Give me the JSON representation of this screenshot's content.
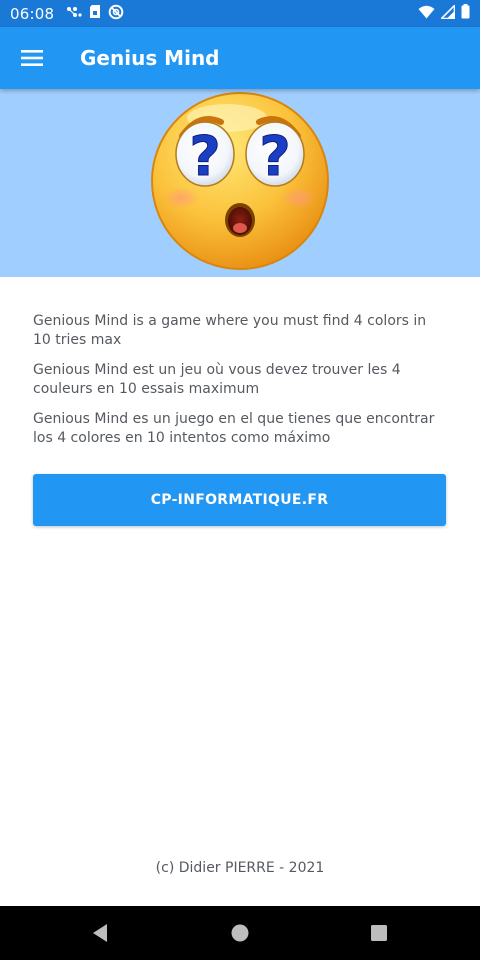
{
  "status_bar": {
    "time": "06:08",
    "left_icons": [
      "network-dots-icon",
      "sim-card-icon",
      "no-disturb-icon"
    ],
    "right_icons": [
      "wifi-icon",
      "signal-icon",
      "battery-icon"
    ]
  },
  "app_bar": {
    "title": "Genius Mind",
    "menu_icon": "hamburger-menu-icon",
    "color": "#2196f3"
  },
  "banner": {
    "background": "#a0cfff",
    "image": "confused-emoji-icon"
  },
  "descriptions": {
    "en": "Genious Mind is a game where you must find 4 colors in 10 tries max",
    "fr": "Genious Mind est un jeu où vous devez trouver les 4 couleurs en 10 essais maximum",
    "es": "Genious Mind es un juego en el que tienes que encontrar los 4 colores en 10 intentos como máximo"
  },
  "website_button": {
    "label": "CP-INFORMATIQUE.FR"
  },
  "footer": {
    "copyright": "(c) Didier PIERRE - 2021"
  },
  "nav_bar": {
    "buttons": [
      "back-icon",
      "home-icon",
      "recents-icon"
    ]
  }
}
